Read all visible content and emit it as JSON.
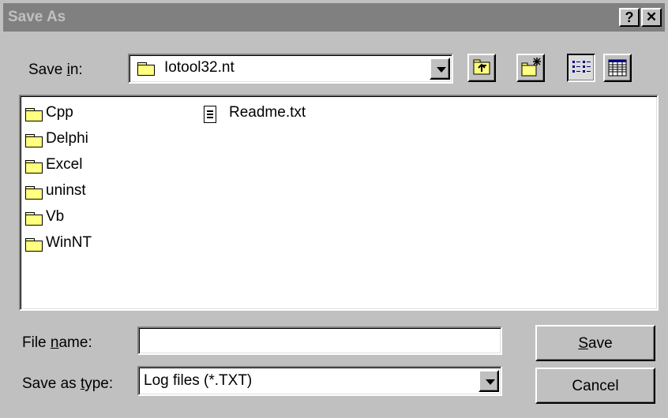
{
  "window": {
    "title": "Save As",
    "help_glyph": "?",
    "close_glyph": "✕"
  },
  "save_in": {
    "label_pre": "Save ",
    "label_access": "i",
    "label_post": "n:",
    "value": "Iotool32.nt"
  },
  "toolbar": [
    "up-one-level-icon",
    "new-folder-icon",
    "list-view-icon",
    "details-view-icon"
  ],
  "files": [
    {
      "name": "Cpp",
      "type": "folder"
    },
    {
      "name": "Delphi",
      "type": "folder"
    },
    {
      "name": "Excel",
      "type": "folder"
    },
    {
      "name": "uninst",
      "type": "folder"
    },
    {
      "name": "Vb",
      "type": "folder"
    },
    {
      "name": "WinNT",
      "type": "folder"
    },
    {
      "name": "Readme.txt",
      "type": "text-file"
    }
  ],
  "file_name": {
    "label_pre": "File ",
    "label_access": "n",
    "label_post": "ame:",
    "value": ""
  },
  "save_as_type": {
    "label_pre": "Save as ",
    "label_access": "t",
    "label_post": "ype:",
    "value": "Log files (*.TXT)"
  },
  "buttons": {
    "save": {
      "access": "S",
      "rest": "ave"
    },
    "cancel": "Cancel"
  },
  "colors": {
    "face": "#c0c0c0",
    "title_inactive": "#808080",
    "folder": "#ffff80"
  }
}
